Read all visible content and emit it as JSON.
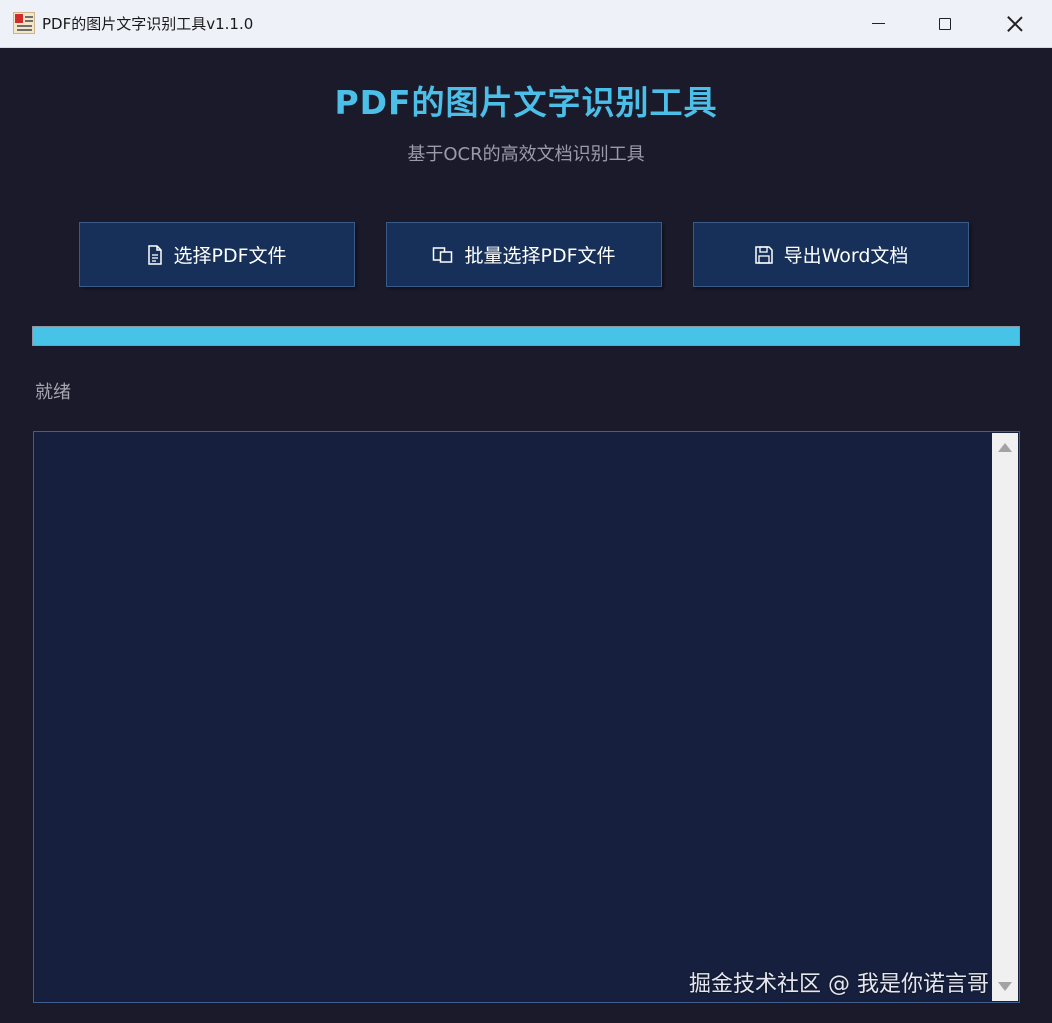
{
  "window": {
    "title": "PDF的图片文字识别工具v1.1.0",
    "controls": {
      "minimize": "minimize-icon",
      "maximize": "maximize-icon",
      "close": "close-icon"
    }
  },
  "header": {
    "title": "PDF的图片文字识别工具",
    "subtitle": "基于OCR的高效文档识别工具",
    "title_color": "#4bbfe8"
  },
  "toolbar": {
    "buttons": [
      {
        "label": "选择PDF文件",
        "icon": "document-icon"
      },
      {
        "label": "批量选择PDF文件",
        "icon": "copy-files-icon"
      },
      {
        "label": "导出Word文档",
        "icon": "save-icon"
      }
    ],
    "button_color": "#16305a"
  },
  "progress": {
    "value_percent": 100,
    "color": "#47c3e8"
  },
  "status": {
    "text": "就绪"
  },
  "log": {
    "text": ""
  },
  "watermark": {
    "text": "掘金技术社区 @ 我是你诺言哥"
  }
}
